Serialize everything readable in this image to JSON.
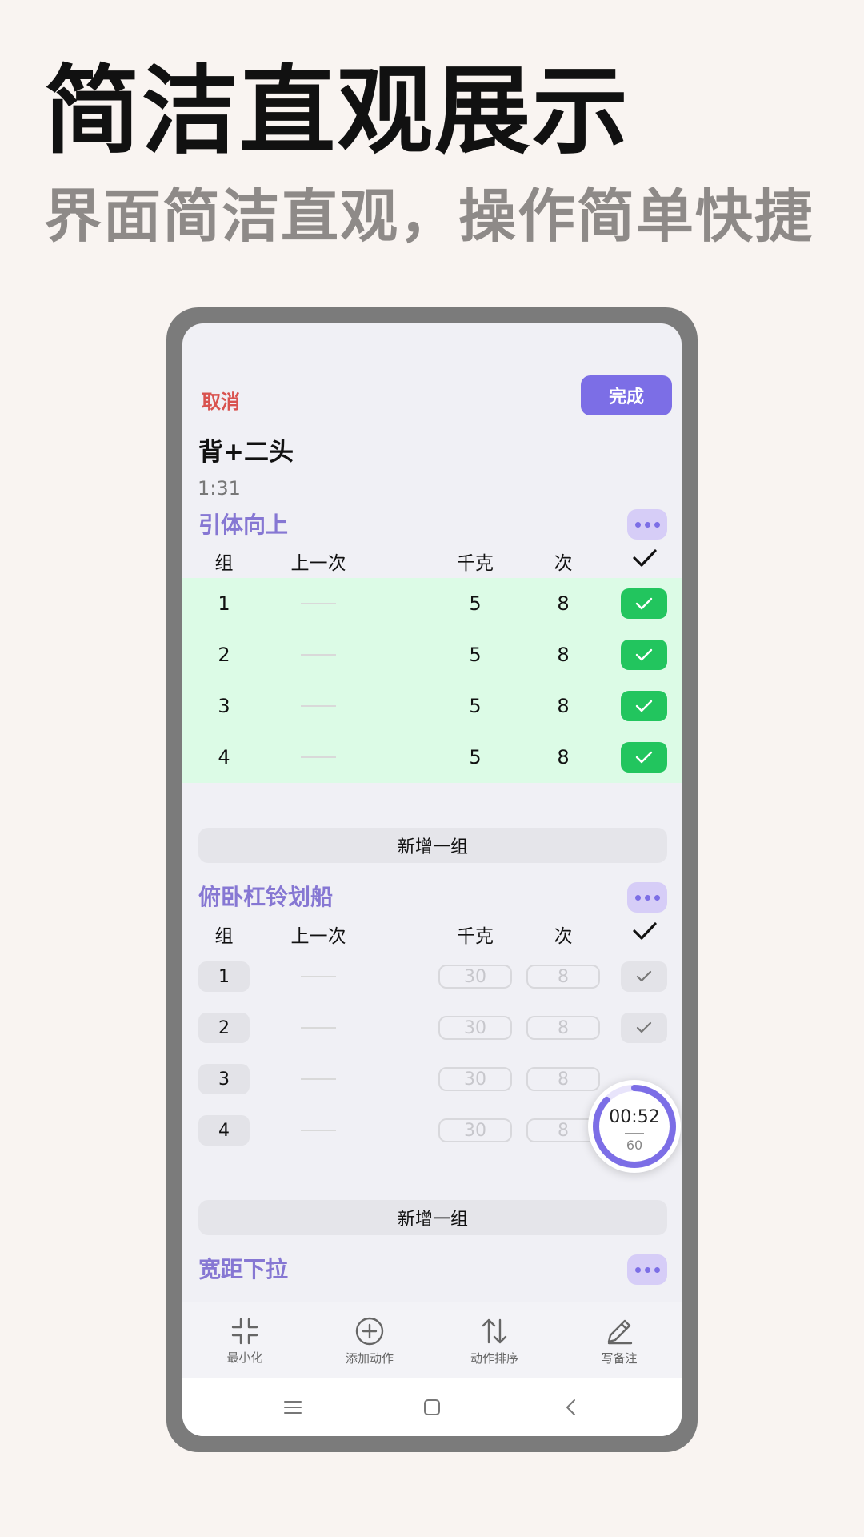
{
  "hero": {
    "title": "简洁直观展示",
    "subtitle": "界面简洁直观，操作简单快捷"
  },
  "header": {
    "cancel_label": "取消",
    "done_label": "完成",
    "routine_name": "背+二头",
    "elapsed": "1:31"
  },
  "columns": {
    "set": "组",
    "previous": "上一次",
    "kg": "千克",
    "reps": "次"
  },
  "exercises": [
    {
      "title": "引体向上",
      "sets": [
        {
          "set": "1",
          "kg": "5",
          "reps": "8",
          "done": true
        },
        {
          "set": "2",
          "kg": "5",
          "reps": "8",
          "done": true
        },
        {
          "set": "3",
          "kg": "5",
          "reps": "8",
          "done": true
        },
        {
          "set": "4",
          "kg": "5",
          "reps": "8",
          "done": true
        }
      ],
      "add_set_label": "新增一组"
    },
    {
      "title": "俯卧杠铃划船",
      "sets": [
        {
          "set": "1",
          "kg": "30",
          "reps": "8",
          "done": false
        },
        {
          "set": "2",
          "kg": "30",
          "reps": "8",
          "done": false
        },
        {
          "set": "3",
          "kg": "30",
          "reps": "8",
          "done": false
        },
        {
          "set": "4",
          "kg": "30",
          "reps": "8",
          "done": false
        }
      ],
      "add_set_label": "新增一组"
    },
    {
      "title": "宽距下拉"
    }
  ],
  "rest_timer": {
    "time": "00:52",
    "total": "60",
    "progress": 0.87
  },
  "toolbar": {
    "minimize": "最小化",
    "add_exercise": "添加动作",
    "reorder": "动作排序",
    "note": "写备注"
  },
  "colors": {
    "accent": "#7c6ee6",
    "done_green": "#22c55e",
    "done_row": "#dcfbe6",
    "cancel_red": "#d9534f"
  }
}
